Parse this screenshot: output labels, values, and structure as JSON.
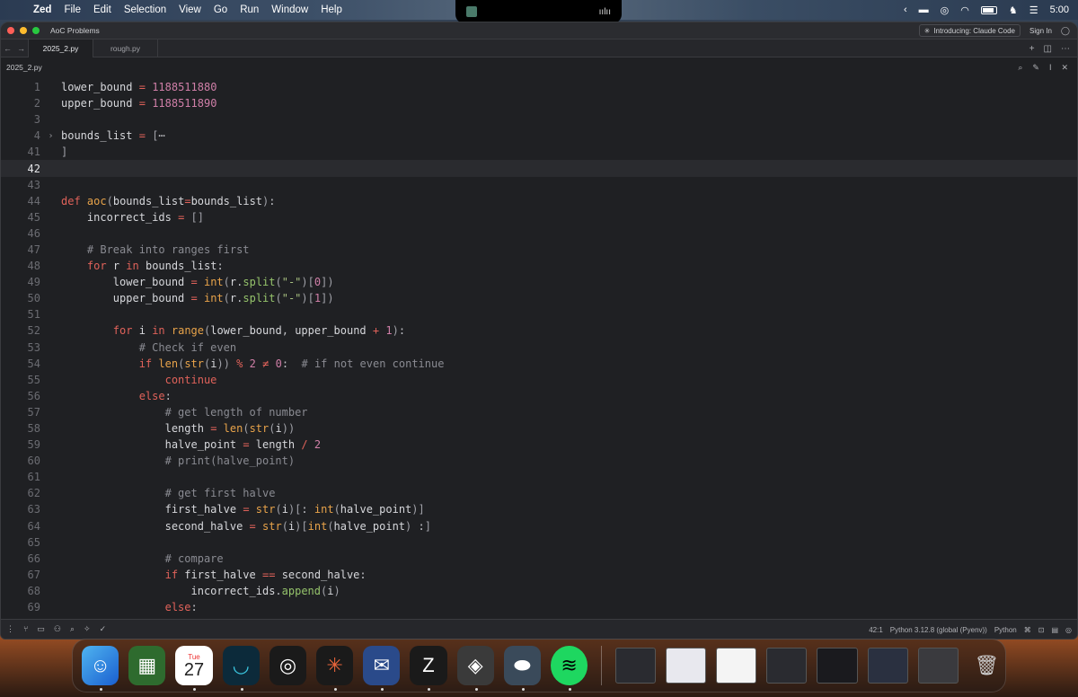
{
  "menubar": {
    "app_name": "Zed",
    "items": [
      "File",
      "Edit",
      "Selection",
      "View",
      "Go",
      "Run",
      "Window",
      "Help"
    ],
    "clock": "5:00"
  },
  "window": {
    "project_name": "AoC Problems",
    "announcement": "Introducing: Claude Code",
    "sign_in": "Sign In"
  },
  "tabs": [
    {
      "label": "2025_2.py",
      "active": true
    },
    {
      "label": "rough.py",
      "active": false
    }
  ],
  "breadcrumb": "2025_2.py",
  "status": {
    "cursor": "42:1",
    "interpreter": "Python 3.12.8 (global (Pyenv))",
    "language": "Python"
  },
  "code": [
    {
      "n": "1",
      "text": "lower_bound = 1188511880"
    },
    {
      "n": "2",
      "text": "upper_bound = 1188511890"
    },
    {
      "n": "3",
      "text": ""
    },
    {
      "n": "4",
      "text": "bounds_list = [⋯",
      "fold": true
    },
    {
      "n": "41",
      "text": "]"
    },
    {
      "n": "42",
      "text": "",
      "current": true
    },
    {
      "n": "43",
      "text": ""
    },
    {
      "n": "44",
      "text": "def aoc(bounds_list=bounds_list):"
    },
    {
      "n": "45",
      "text": "    incorrect_ids = []"
    },
    {
      "n": "46",
      "text": ""
    },
    {
      "n": "47",
      "text": "    # Break into ranges first"
    },
    {
      "n": "48",
      "text": "    for r in bounds_list:"
    },
    {
      "n": "49",
      "text": "        lower_bound = int(r.split(\"-\")[0])"
    },
    {
      "n": "50",
      "text": "        upper_bound = int(r.split(\"-\")[1])"
    },
    {
      "n": "51",
      "text": ""
    },
    {
      "n": "52",
      "text": "        for i in range(lower_bound, upper_bound + 1):"
    },
    {
      "n": "53",
      "text": "            # Check if even"
    },
    {
      "n": "54",
      "text": "            if len(str(i)) % 2 ≠ 0:  # if not even continue"
    },
    {
      "n": "55",
      "text": "                continue"
    },
    {
      "n": "56",
      "text": "            else:"
    },
    {
      "n": "57",
      "text": "                # get length of number"
    },
    {
      "n": "58",
      "text": "                length = len(str(i))"
    },
    {
      "n": "59",
      "text": "                halve_point = length / 2"
    },
    {
      "n": "60",
      "text": "                # print(halve_point)"
    },
    {
      "n": "61",
      "text": ""
    },
    {
      "n": "62",
      "text": "                # get first halve"
    },
    {
      "n": "63",
      "text": "                first_halve = str(i)[: int(halve_point)]"
    },
    {
      "n": "64",
      "text": "                second_halve = str(i)[int(halve_point) :]"
    },
    {
      "n": "65",
      "text": ""
    },
    {
      "n": "66",
      "text": "                # compare"
    },
    {
      "n": "67",
      "text": "                if first_halve == second_halve:"
    },
    {
      "n": "68",
      "text": "                    incorrect_ids.append(i)"
    },
    {
      "n": "69",
      "text": "                else:"
    }
  ],
  "dock": {
    "calendar_day": "Tue",
    "calendar_date": "27",
    "apps": [
      "Finder",
      "Minecraft",
      "Calendar",
      "Surfshark",
      "Omnissa",
      "Claude",
      "Mail",
      "Zed",
      "Parallels",
      "Stocks",
      "Spotify"
    ]
  },
  "colors": {
    "editor_bg": "#1f2023",
    "keyword": "#e0625a",
    "function": "#e8a34a",
    "number": "#d07fa8",
    "string": "#a7c080",
    "comment": "#8a8b92"
  }
}
